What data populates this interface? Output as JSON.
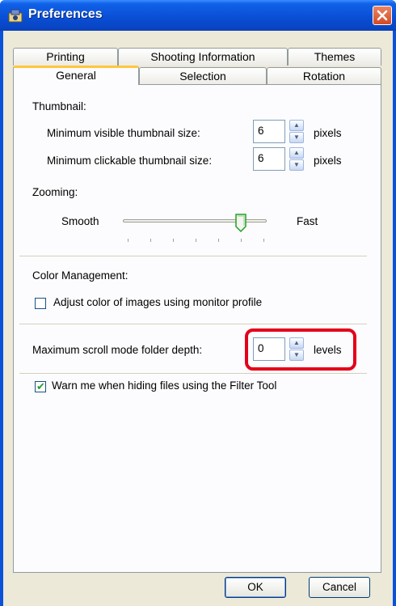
{
  "window": {
    "title": "Preferences",
    "icons": {
      "app": "preferences-app-icon",
      "close": "close-icon"
    }
  },
  "tabs": {
    "back_row": [
      "Printing",
      "Shooting Information",
      "Themes"
    ],
    "front_row": [
      "General",
      "Selection",
      "Rotation"
    ],
    "active": "General"
  },
  "thumbnail": {
    "heading": "Thumbnail:",
    "min_visible_label": "Minimum visible thumbnail size:",
    "min_visible_value": "6",
    "min_clickable_label": "Minimum clickable thumbnail size:",
    "min_clickable_value": "6",
    "unit": "pixels"
  },
  "zooming": {
    "heading": "Zooming:",
    "left_label": "Smooth",
    "right_label": "Fast",
    "position": 5,
    "steps": 7
  },
  "color_management": {
    "heading": "Color Management:",
    "adjust_label": "Adjust color of images using monitor profile",
    "adjust_checked": false
  },
  "scroll_depth": {
    "label": "Maximum scroll mode folder depth:",
    "value": "0",
    "unit": "levels"
  },
  "filter_warning": {
    "label": "Warn me when hiding files using the Filter Tool",
    "checked": true
  },
  "buttons": {
    "ok": "OK",
    "cancel": "Cancel"
  },
  "colors": {
    "highlight": "#e3001a",
    "titlebar": "#0a4fd6"
  }
}
